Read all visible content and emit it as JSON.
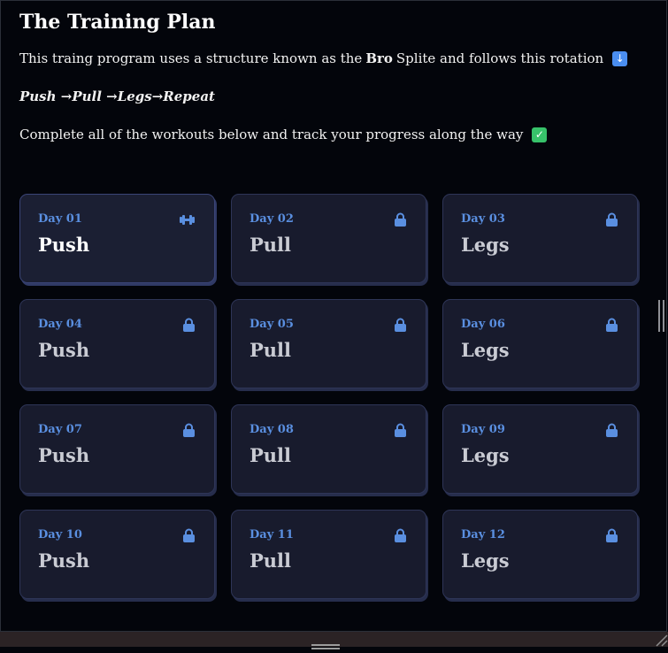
{
  "header": {
    "title": "The Training Plan",
    "intro_prefix": "This traing program uses a structure known as the",
    "intro_bold": "Bro",
    "intro_suffix": "Splite and follows this rotation",
    "rotation": "Push →Pull →Legs→Repeat",
    "instruction": "Complete all of the workouts below and track your progress along the way"
  },
  "workouts": [
    {
      "day": "Day 01",
      "name": "Push",
      "icon": "dumbbell-icon",
      "status": "active"
    },
    {
      "day": "Day 02",
      "name": "Pull",
      "icon": "lock-icon",
      "status": "locked"
    },
    {
      "day": "Day 03",
      "name": "Legs",
      "icon": "lock-icon",
      "status": "locked"
    },
    {
      "day": "Day 04",
      "name": "Push",
      "icon": "lock-icon",
      "status": "locked"
    },
    {
      "day": "Day 05",
      "name": "Pull",
      "icon": "lock-icon",
      "status": "locked"
    },
    {
      "day": "Day 06",
      "name": "Legs",
      "icon": "lock-icon",
      "status": "locked"
    },
    {
      "day": "Day 07",
      "name": "Push",
      "icon": "lock-icon",
      "status": "locked"
    },
    {
      "day": "Day 08",
      "name": "Pull",
      "icon": "lock-icon",
      "status": "locked"
    },
    {
      "day": "Day 09",
      "name": "Legs",
      "icon": "lock-icon",
      "status": "locked"
    },
    {
      "day": "Day 10",
      "name": "Push",
      "icon": "lock-icon",
      "status": "locked"
    },
    {
      "day": "Day 11",
      "name": "Pull",
      "icon": "lock-icon",
      "status": "locked"
    },
    {
      "day": "Day 12",
      "name": "Legs",
      "icon": "lock-icon",
      "status": "locked"
    }
  ],
  "colors": {
    "background": "#03050b",
    "card": "#181b2d",
    "accent": "#5a8fe0",
    "bottom_bar": "#2b2325"
  }
}
